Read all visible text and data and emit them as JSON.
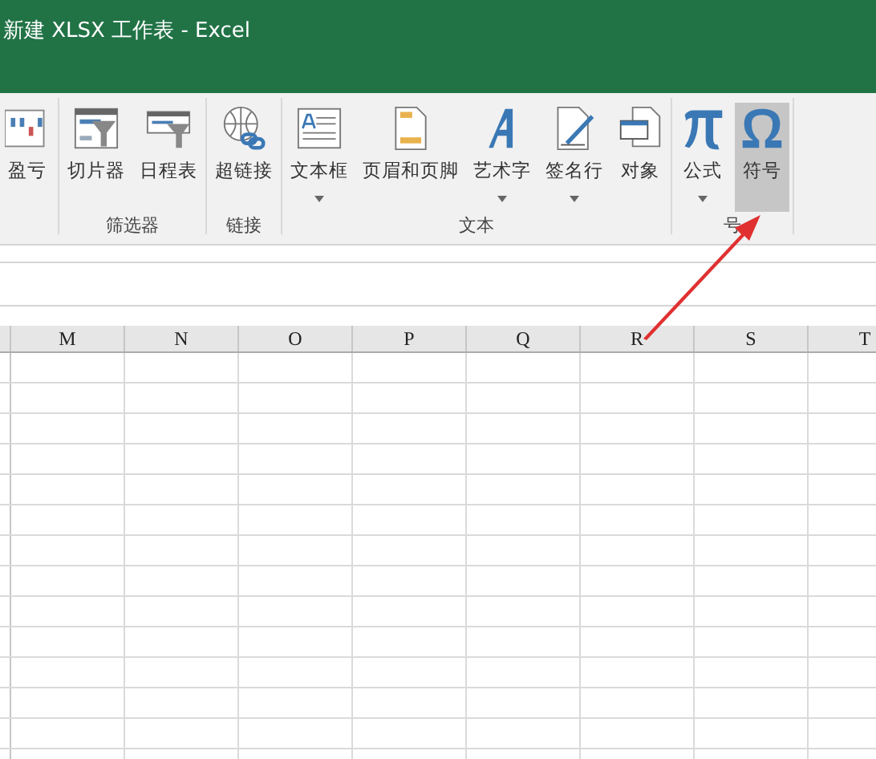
{
  "window": {
    "title": "新建 XLSX 工作表 - Excel"
  },
  "ribbon": {
    "groups": [
      {
        "buttons": [
          {
            "label": "盈亏",
            "kind": "sparkline",
            "dropdown": false,
            "selected": false
          }
        ]
      },
      {
        "label": "筛选器",
        "buttons": [
          {
            "label": "切片器",
            "kind": "slicer",
            "dropdown": false,
            "selected": false
          },
          {
            "label": "日程表",
            "kind": "timeline",
            "dropdown": false,
            "selected": false
          }
        ]
      },
      {
        "label": "链接",
        "buttons": [
          {
            "label": "超链接",
            "kind": "link",
            "dropdown": false,
            "selected": false
          }
        ]
      },
      {
        "label": "文本",
        "buttons": [
          {
            "label": "文本框",
            "kind": "textbox",
            "dropdown": true,
            "selected": false
          },
          {
            "label": "页眉和页脚",
            "kind": "header",
            "dropdown": false,
            "selected": false
          },
          {
            "label": "艺术字",
            "kind": "wordart",
            "dropdown": true,
            "selected": false
          },
          {
            "label": "签名行",
            "kind": "signature",
            "dropdown": true,
            "selected": false
          },
          {
            "label": "对象",
            "kind": "object",
            "dropdown": false,
            "selected": false
          }
        ]
      },
      {
        "label": "号",
        "buttons": [
          {
            "label": "公式",
            "kind": "pi",
            "dropdown": true,
            "selected": false
          },
          {
            "label": "符号",
            "kind": "omega",
            "dropdown": false,
            "selected": true
          }
        ]
      }
    ]
  },
  "sheet": {
    "columns": [
      "M",
      "N",
      "O",
      "P",
      "Q",
      "R",
      "S",
      "T"
    ]
  }
}
